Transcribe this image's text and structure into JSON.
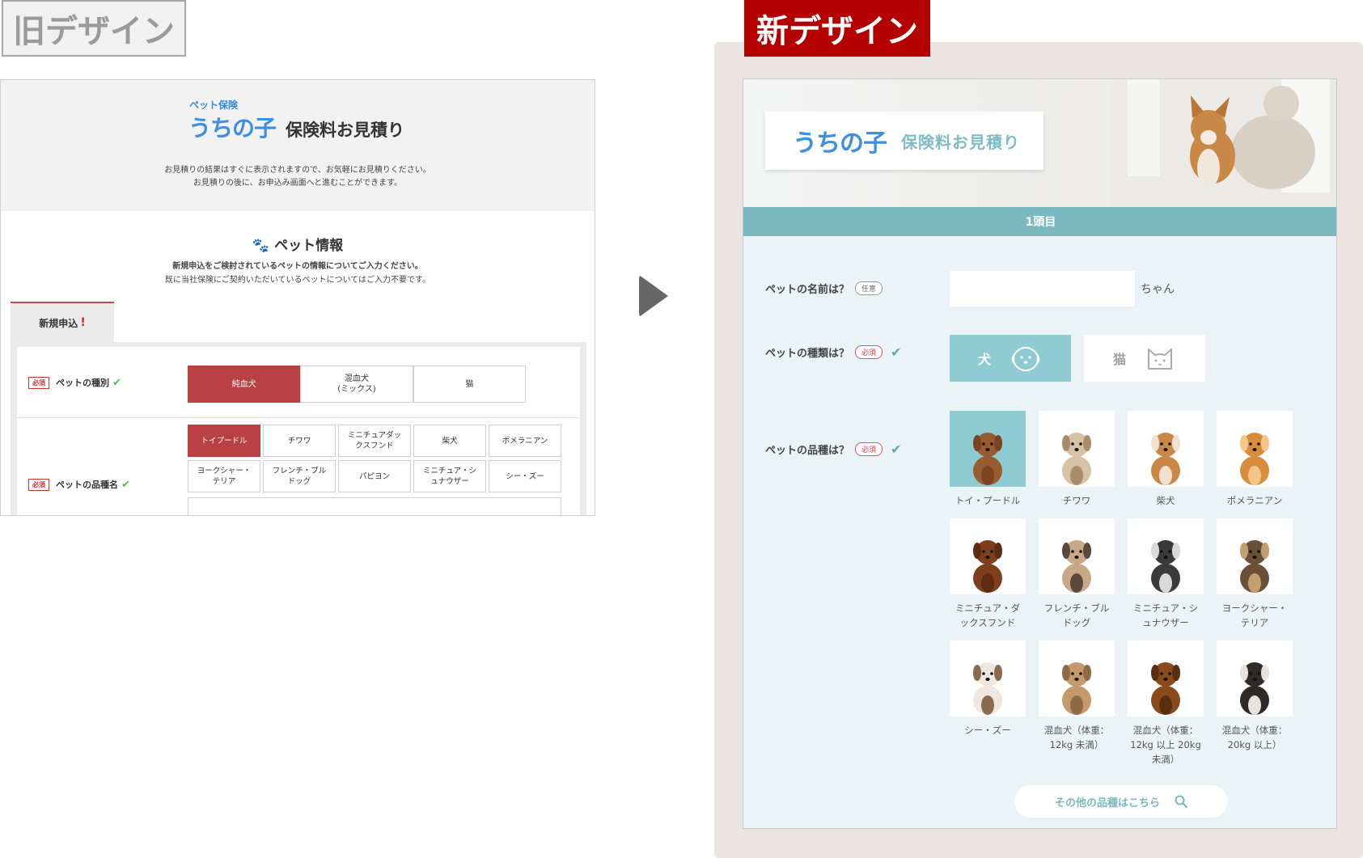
{
  "labels": {
    "old": "旧デザイン",
    "new": "新デザイン"
  },
  "old": {
    "logo_small": "ペット保険",
    "logo_big": "うちの子",
    "title": "保険料お見積り",
    "desc_line1": "お見積りの結果はすぐに表示されますので、お気軽にお見積りください。",
    "desc_line2": "お見積りの後に、お申込み画面へと進むことができます。",
    "section_title": "ペット情報",
    "section_desc_line1": "新規申込をご検討されているペットの情報についてご入力ください。",
    "section_desc_line2": "既に当社保険にご契約いただいているペットについてはご入力不要です。",
    "tab_label": "新規申込",
    "tab_mark": "!",
    "required_badge": "必須",
    "type_label": "ペットの種別",
    "type_options": [
      "純血犬",
      "混血犬\n(ミックス)",
      "猫"
    ],
    "breed_label": "ペットの品種名",
    "breed_options": [
      "トイプードル",
      "チワワ",
      "ミニチュアダッ\nクスフンド",
      "柴犬",
      "ポメラニアン",
      "ヨークシャー・\nテリア",
      "フレンチ・ブル\nドッグ",
      "パピヨン",
      "ミニチュア・シ\nュナウザー",
      "シー・ズー"
    ]
  },
  "new": {
    "logo": "うちの子",
    "title": "保険料お見積り",
    "pet_bar": "1頭目",
    "name_label": "ペットの名前は？",
    "optional_badge": "任意",
    "name_value": "",
    "name_suffix": "ちゃん",
    "type_label": "ペットの種類は？",
    "required_badge": "必須",
    "type_dog": "犬",
    "type_cat": "猫",
    "breed_label": "ペットの品種は？",
    "breeds": [
      "トイ・プードル",
      "チワワ",
      "柴犬",
      "ポメラニアン",
      "ミニチュア・ダ\nックスフンド",
      "フレンチ・ブル\nドッグ",
      "ミニチュア・シ\nュナウザー",
      "ヨークシャー・\nテリア",
      "シー・ズー",
      "混血犬（体重：\n12kg 未満）",
      "混血犬（体重：\n12kg 以上 20kg\n未満）",
      "混血犬（体重：\n20kg 以上）"
    ],
    "more_button": "その他の品種はこちら"
  },
  "colors": {
    "accent": "#7ab9bf",
    "selected": "#8fcbd2",
    "old_red": "#b94143",
    "new_label": "#b40000"
  },
  "icons": {
    "paw": "paw-icon",
    "check": "check-icon",
    "search": "search-icon",
    "dog_face": "dog-face-icon",
    "cat_face": "cat-face-icon"
  }
}
